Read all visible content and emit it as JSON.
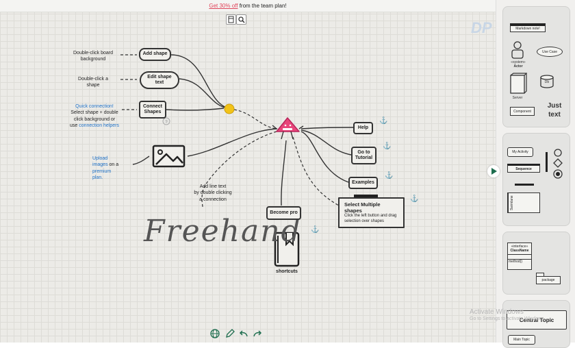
{
  "promo": {
    "link": "Get 30% off",
    "text": " from the team plan!"
  },
  "toolbar": {
    "page_icon": "page-icon",
    "zoom_icon": "search-icon"
  },
  "annotations": {
    "dbl_board_1": "Double-click board",
    "dbl_board_2": "background",
    "dbl_shape_1": "Double-click a",
    "dbl_shape_2": "shape",
    "quick_conn": "Quick connection!",
    "quick_conn_2": "Select shape + double",
    "quick_conn_3": "click background or",
    "quick_conn_4": "use",
    "quick_conn_link": "connection helpers",
    "upload_1": "Upload",
    "upload_2": "images",
    "upload_3": " on a",
    "upload_4": "premium",
    "upload_5": "plan.",
    "line_text_1": "Add line text",
    "line_text_2": "by double clicking",
    "line_text_3": "a connection",
    "shortcuts": "shortcuts",
    "freehand": "Freehand"
  },
  "nodes": {
    "add_shape": "Add shape",
    "edit_shape_1": "Edit shape",
    "edit_shape_2": "text",
    "connect_1": "Connect",
    "connect_2": "Shapes",
    "help": "Help",
    "tutorial_1": "Go to",
    "tutorial_2": "Tutorial",
    "examples": "Examples",
    "become_pro": "Become pro",
    "select_title": "Select Multiple shapes",
    "select_body_1": "Click the left button and drag",
    "select_body_2": "selection over shapes"
  },
  "panel": {
    "markdown_note": "Markdown note!",
    "use_case": "Use Case",
    "actor_stereo": "«system»",
    "actor": "Actor",
    "server": "Server",
    "db": "Db",
    "component": "Component",
    "just_text_1": "Just",
    "just_text_2": "text",
    "my_activity": "My Activity",
    "sequence": "Sequence",
    "swimlane": "Swimlane",
    "interface_1": "«interface»",
    "interface_2": "ClassName",
    "method": "method()",
    "package": "package",
    "central_topic": "Central Topic",
    "main_topic": "Main Topic"
  },
  "watermark": {
    "line1": "Activate Windows",
    "line2": "Go to Settings to activate Windows."
  },
  "logo": "DP",
  "colors": {
    "accent": "#e8457a",
    "yellow": "#f2c318",
    "anchor": "#1d6d4e",
    "link": "#2173c9"
  }
}
